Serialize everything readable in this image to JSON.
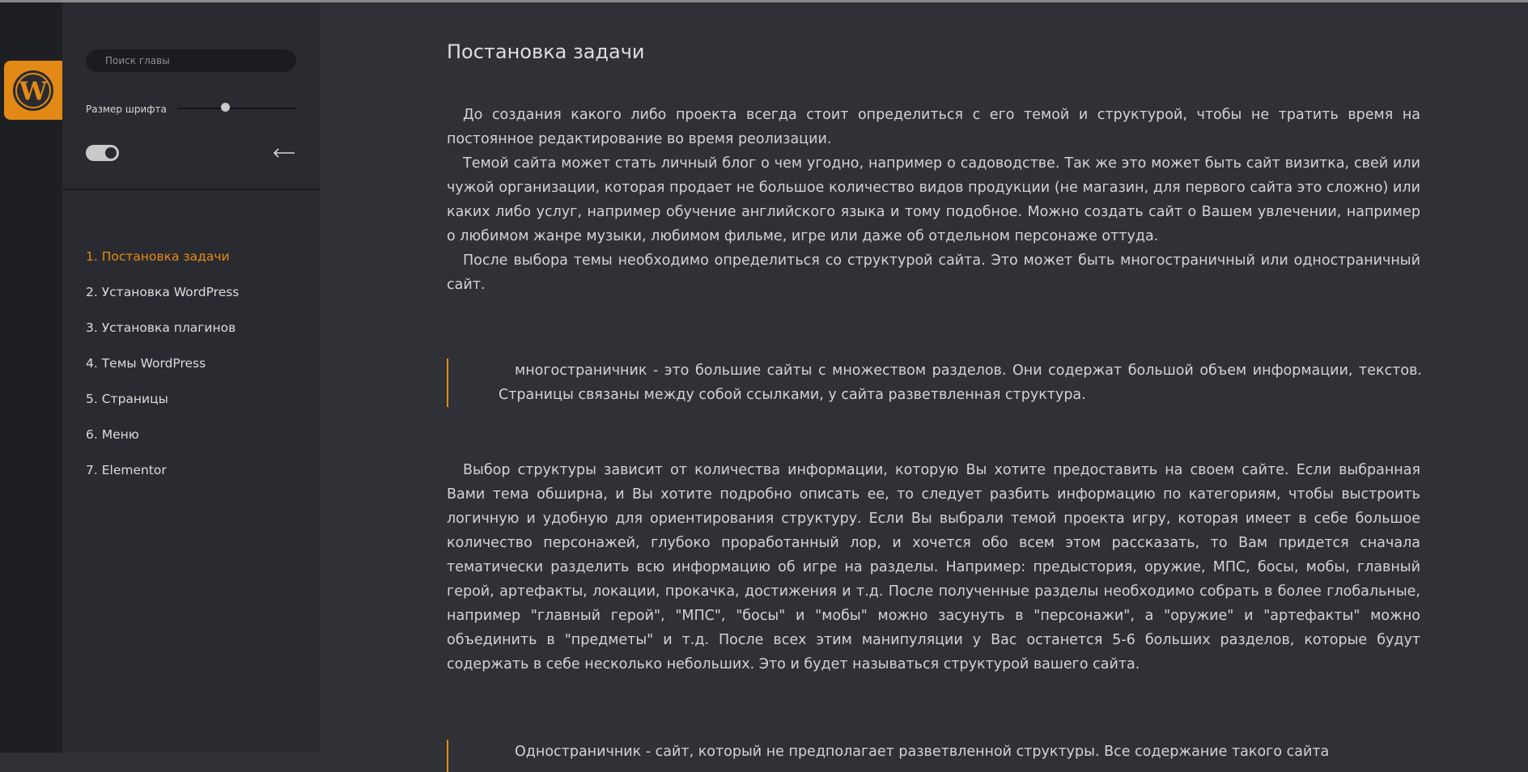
{
  "colors": {
    "accent": "#e38a16",
    "background": "#2f3136",
    "sidebar": "#2a2b30",
    "rail": "#1e1f23"
  },
  "logo": {
    "icon": "wordpress-logo-icon"
  },
  "sidebar": {
    "search_placeholder": "Поиск главы",
    "font_size_label": "Размер шрифта",
    "font_size_level": 0.4,
    "theme_toggle_on": true,
    "back_icon": "arrow-left-icon",
    "chapters": [
      {
        "label": "1. Постановка задачи",
        "active": true
      },
      {
        "label": "2. Установка WordPress",
        "active": false
      },
      {
        "label": "3. Установка плагинов",
        "active": false
      },
      {
        "label": "4. Темы WordPress",
        "active": false
      },
      {
        "label": "5. Страницы",
        "active": false
      },
      {
        "label": "6. Меню",
        "active": false
      },
      {
        "label": "7. Elementor",
        "active": false
      }
    ]
  },
  "main": {
    "title": "Постановка задачи",
    "paragraphs": [
      "До создания какого либо проекта всегда стоит определиться с его темой и структурой, чтобы не тратить время на постоянное редактирование во время реолизации.",
      "Темой сайта может стать личный блог о чем угодно, например о садоводстве. Так же это может быть сайт визитка, свей или чужой организации, которая продает не большое количество видов продукции (не магазин, для первого сайта это сложно) или каких либо услуг, например обучение английского языка и тому подобное. Можно создать сайт о Вашем увлечении, например о любимом жанре музыки, любимом фильме, игре или даже об отдельном персонаже оттуда.",
      "После выбора темы необходимо определиться со структурой сайта. Это может быть многостраничный или одностраничный сайт."
    ],
    "quote1": "многостраничник - это большие сайты с множеством разделов. Они содержат большой объем информации, текстов. Страницы связаны между собой ссылками, у сайта разветвленная структура.",
    "paragraph_structure": "Выбор структуры зависит от количества информации, которую Вы хотите предоставить на своем сайте. Если выбранная Вами тема обширна, и Вы хотите подробно описать ее, то следует разбить информацию по категориям, чтобы выстроить логичную и удобную для ориентирования структуру. Если Вы выбрали темой проекта игру, которая имеет в себе большое количество персонажей, глубоко проработанный лор, и хочется обо всем этом рассказать, то Вам придется сначала тематически разделить всю информацию об игре на разделы. Например: предыстория, оружие, МПС, босы, мобы, главный герой, артефакты, локации, прокачка, достижения и т.д. После полученные разделы необходимо собрать в более глобальные, например \"главный герой\", \"МПС\", \"босы\" и \"мобы\" можно засунуть в \"персонажи\", а \"оружие\" и \"артефакты\" можно объединить в \"предметы\" и т.д. После всех этим манипуляции у Вас останется 5-6 больших разделов, которые будут содержать в себе несколько небольших. Это и будет называться структурой вашего сайта.",
    "quote2": "Одностраничник - сайт, который не предполагает разветвленной структуры. Все содержание такого сайта"
  }
}
